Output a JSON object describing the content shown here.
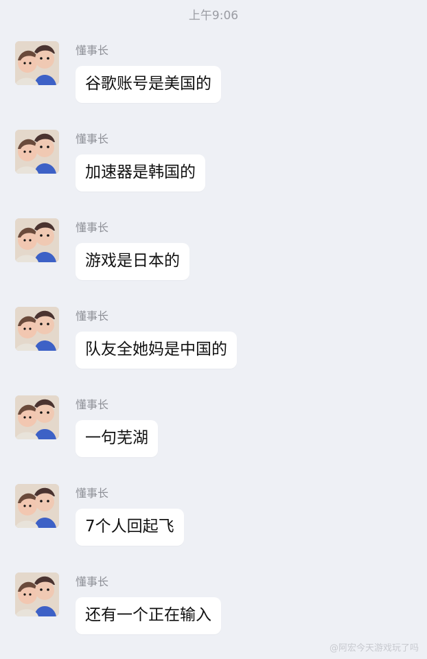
{
  "timestamp": "上午9:06",
  "sender_name": "懂事长",
  "messages": [
    {
      "text": "谷歌账号是美国的"
    },
    {
      "text": "加速器是韩国的"
    },
    {
      "text": "游戏是日本的"
    },
    {
      "text": "队友全她妈是中国的"
    },
    {
      "text": "一句芜湖"
    },
    {
      "text": "7个人回起飞"
    },
    {
      "text": "还有一个正在输入"
    }
  ],
  "watermark": "@阿宏今天游戏玩了吗",
  "colors": {
    "background": "#eef0f5",
    "bubble": "#ffffff",
    "meta_text": "#8e9097"
  },
  "icons": {
    "avatar": "cartoon-couple-avatar"
  }
}
